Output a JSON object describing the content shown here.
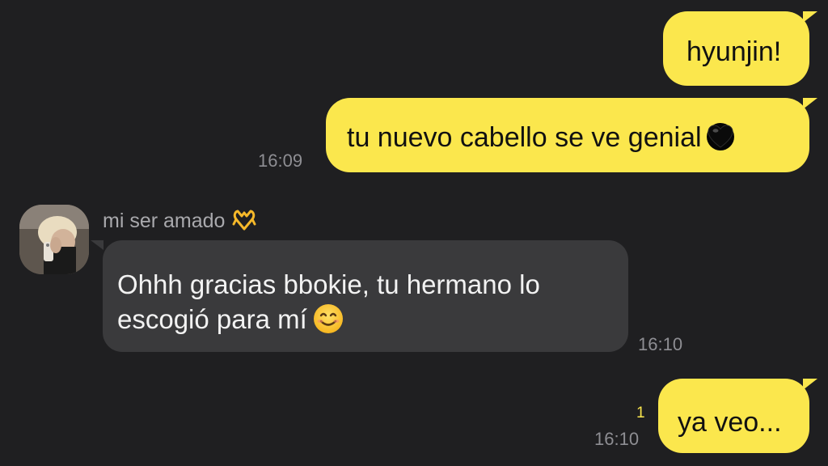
{
  "messages": [
    {
      "from": "me",
      "text": "hyunjin!"
    },
    {
      "from": "me",
      "text": "tu nuevo cabello se ve genial",
      "icon": "black-heart-icon",
      "time": "16:09"
    },
    {
      "from": "contact",
      "sender": "mi ser amado",
      "sender_icon": "heart-hands-icon",
      "lines": [
        "Ohhh gracias bbokie, tu hermano lo",
        "escogió para mí"
      ],
      "icon": "smiling-face-icon",
      "time": "16:10"
    },
    {
      "from": "me",
      "text": "ya veo...",
      "time": "16:10",
      "unread_count": "1"
    }
  ],
  "colors": {
    "background": "#1f1f21",
    "outgoing_bubble": "#fbe74d",
    "incoming_bubble": "#3a3a3c",
    "timestamp": "#8e8e93",
    "unread": "#fbe74d"
  }
}
